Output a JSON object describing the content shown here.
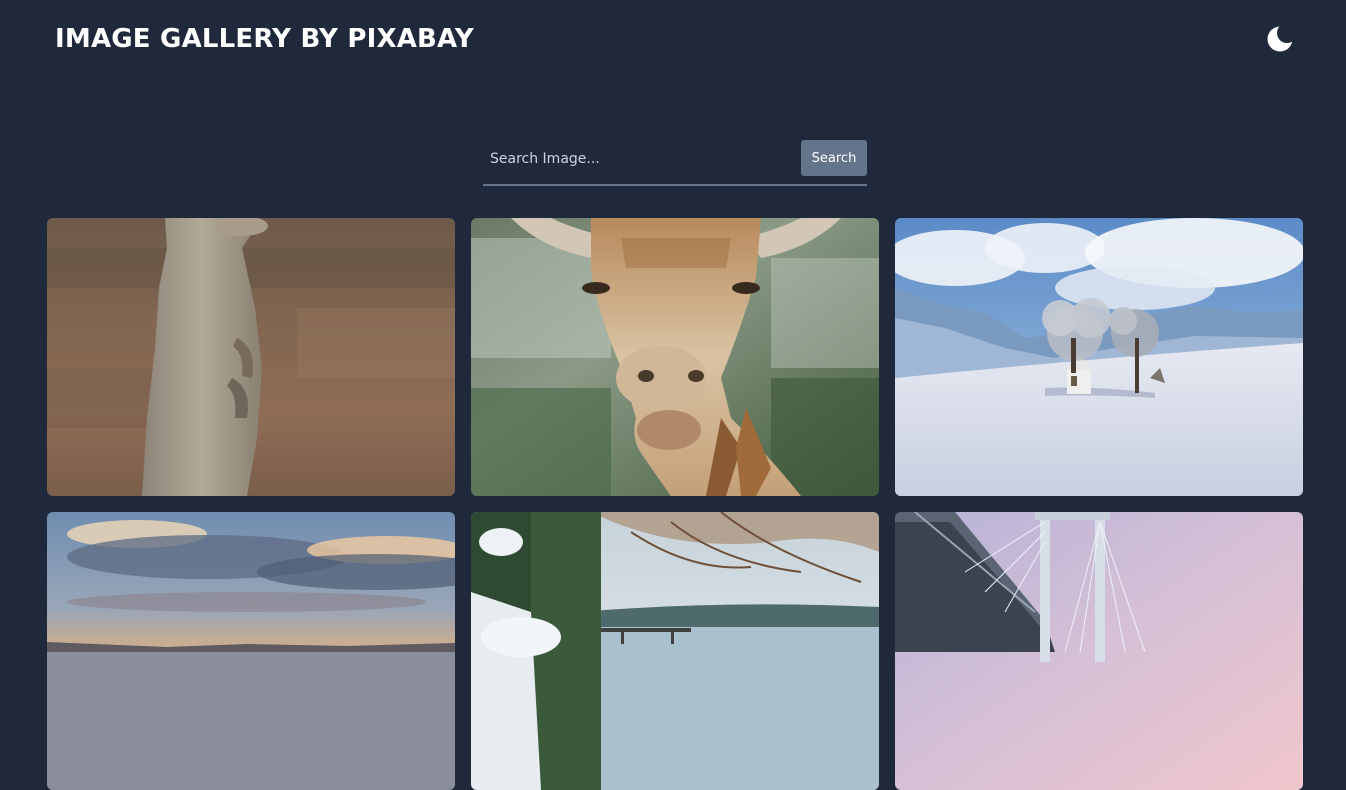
{
  "header": {
    "title": "IMAGE GALLERY BY PIXABAY",
    "theme_icon": "moon-icon"
  },
  "search": {
    "placeholder": "Search Image...",
    "value": "",
    "button_label": "Search"
  },
  "gallery": {
    "images": [
      {
        "subject": "meerkat"
      },
      {
        "subject": "giraffe"
      },
      {
        "subject": "winter-landscape"
      },
      {
        "subject": "sunset-lake"
      },
      {
        "subject": "snowy-lake-shore"
      },
      {
        "subject": "cable-bridge"
      }
    ]
  },
  "colors": {
    "background": "#1f293b",
    "title": "#ffffff",
    "button": "#64748b",
    "search_underline": "#64748b"
  }
}
